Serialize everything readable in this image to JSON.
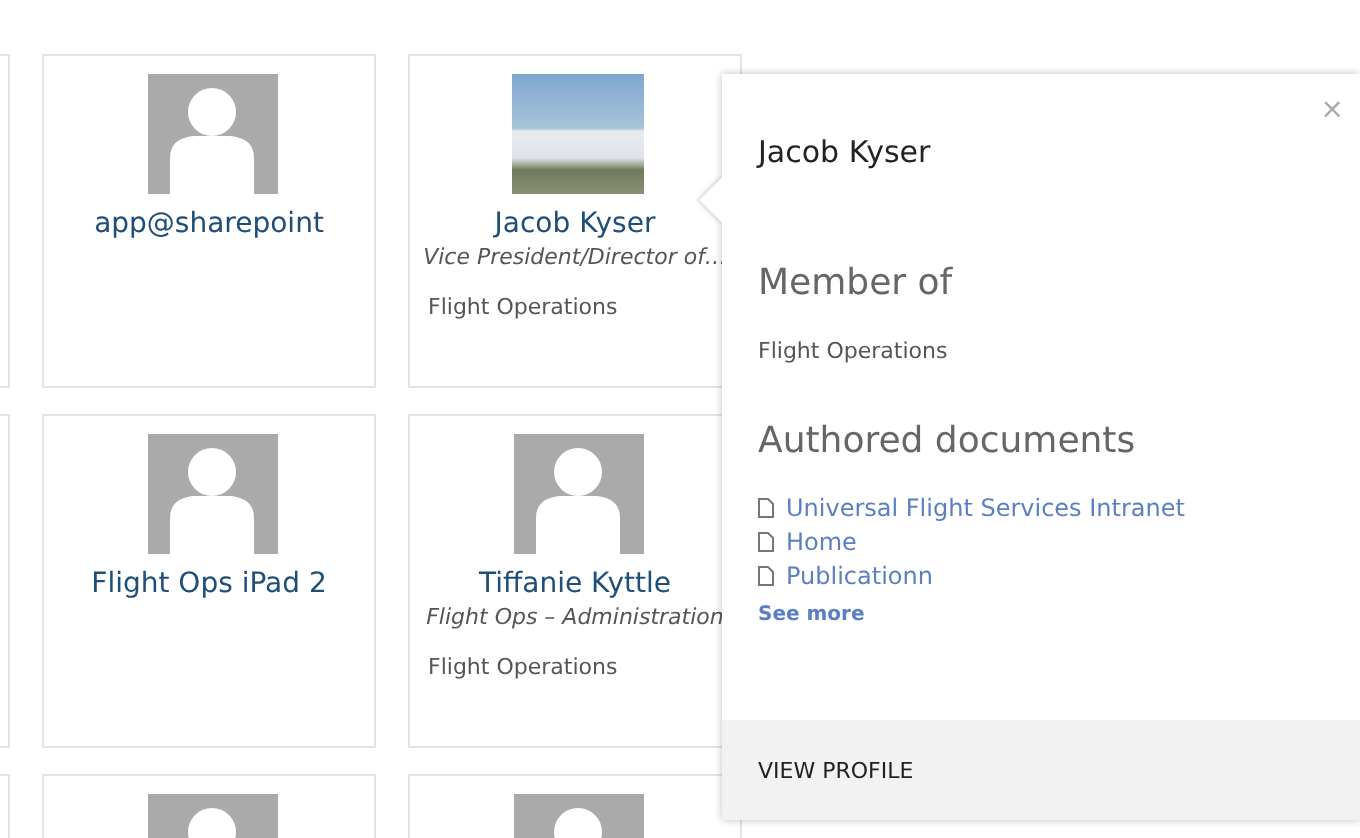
{
  "people": [
    {
      "kind": "silhouette",
      "name": "app@sharepoint"
    },
    {
      "kind": "photo",
      "name": "Jacob Kyser",
      "title": "Vice President/Director of…",
      "department": "Flight Operations"
    },
    {
      "kind": "silhouette",
      "name": "Flight Ops iPad 2"
    },
    {
      "kind": "silhouette",
      "name": "Tiffanie Kyttle",
      "title": "Flight Ops – Administration",
      "department": "Flight Operations"
    },
    {
      "kind": "silhouette"
    },
    {
      "kind": "silhouette"
    }
  ],
  "popup": {
    "name": "Jacob Kyser",
    "close": "×",
    "member_heading": "Member of",
    "member_of": [
      "Flight Operations"
    ],
    "documents_heading": "Authored documents",
    "documents": [
      "Universal Flight Services Intranet",
      "Home",
      "Publicationn"
    ],
    "see_more": "See more",
    "action": "VIEW PROFILE"
  }
}
